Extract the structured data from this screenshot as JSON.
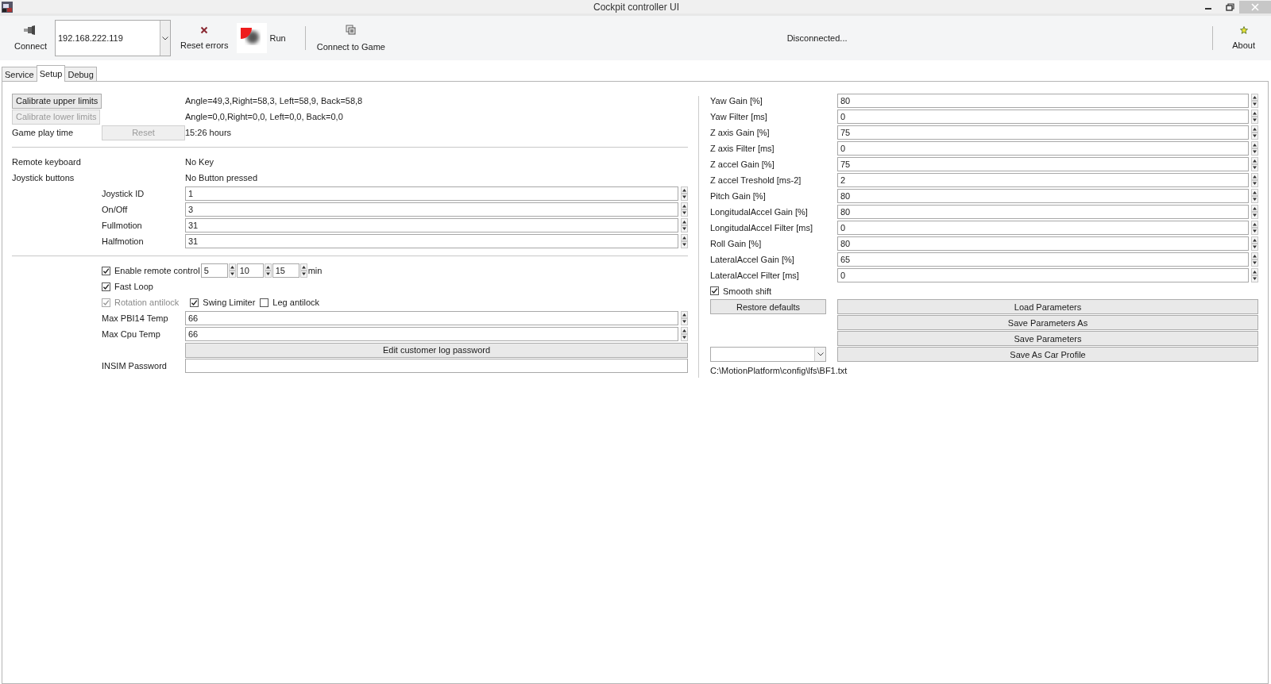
{
  "window": {
    "title": "Cockpit controller UI"
  },
  "toolbar": {
    "connect_button": {
      "label": "Connect"
    },
    "address": {
      "value": "192.168.222.119"
    },
    "reset_button": {
      "label": "Reset errors"
    },
    "run_button": {
      "label": "Run"
    },
    "connect_game_button": {
      "label": "Connect to Game"
    },
    "status": "Disconnected...",
    "about_button": {
      "label": "About"
    }
  },
  "tabs": [
    {
      "label": "Service",
      "selected": false
    },
    {
      "label": "Setup",
      "selected": true
    },
    {
      "label": "Debug",
      "selected": false
    }
  ],
  "calibration": [
    {
      "label": "Calibrate upper limits",
      "disabled": false,
      "reading": "Angle=49,3,Right=58,3, Left=58,9, Back=58,8"
    },
    {
      "label": "Calibrate lower limits",
      "disabled": true,
      "reading": "Angle=0,0,Right=0,0, Left=0,0, Back=0,0"
    }
  ],
  "game_play": {
    "label": "Game play  time",
    "reset_button": {
      "label": "Reset",
      "disabled": true
    },
    "value": "15:26 hours"
  },
  "remote_keyboard": {
    "label": "Remote keyboard",
    "value": "No Key"
  },
  "joystick_buttons": {
    "label": "Joystick buttons",
    "value": "No Button pressed",
    "fields": [
      {
        "label": "Joystick ID",
        "value": "1"
      },
      {
        "label": "On/Off",
        "value": "3"
      },
      {
        "label": "Fullmotion",
        "value": "31"
      },
      {
        "label": "Halfmotion",
        "value": "31"
      }
    ]
  },
  "remote_control": {
    "label": "Enable remote control",
    "checked": true,
    "values": [
      "5",
      "10",
      "15"
    ],
    "unit": "min"
  },
  "option_rows": [
    [
      {
        "label": "Fast Loop",
        "checked": true,
        "disabled": false
      }
    ],
    [
      {
        "label": "Rotation antilock",
        "checked": true,
        "disabled": true
      },
      {
        "label": "Swing Limiter",
        "checked": true,
        "disabled": false
      },
      {
        "label": "Leg antilock",
        "checked": false,
        "disabled": false
      }
    ]
  ],
  "temperatures": [
    {
      "label": "Max PBI14 Temp",
      "value": "66"
    },
    {
      "label": "Max Cpu Temp",
      "value": "66"
    }
  ],
  "edit_password_button": {
    "label": "Edit customer log password"
  },
  "insim_password": {
    "label": "INSIM Password"
  },
  "parameters": [
    {
      "label": "Yaw Gain [%]",
      "value": "80"
    },
    {
      "label": "Yaw Filter [ms]",
      "value": "0"
    },
    {
      "label": "Z axis Gain [%]",
      "value": "75"
    },
    {
      "label": "Z axis Filter [ms]",
      "value": "0"
    },
    {
      "label": "Z accel Gain [%]",
      "value": "75"
    },
    {
      "label": "Z accel Treshold [ms-2]",
      "value": "2"
    },
    {
      "label": "Pitch Gain [%]",
      "value": "80"
    },
    {
      "label": "LongitudalAccel Gain [%]",
      "value": "80"
    },
    {
      "label": "LongitudalAccel Filter [ms]",
      "value": "0"
    },
    {
      "label": "Roll Gain [%]",
      "value": "80"
    },
    {
      "label": "LateralAccel Gain [%]",
      "value": "65"
    },
    {
      "label": "LateralAccel Filter [ms]",
      "value": "0"
    }
  ],
  "smooth_shift": {
    "label": "Smooth shift",
    "checked": true
  },
  "restore_button": {
    "label": "Restore defaults"
  },
  "file_buttons": [
    {
      "label": "Load Parameters"
    },
    {
      "label": "Save Parameters As"
    },
    {
      "label": "Save Parameters"
    },
    {
      "label": "Save As Car Profile"
    }
  ],
  "profile_path": "C:\\MotionPlatform\\config\\lfs\\BF1.txt"
}
